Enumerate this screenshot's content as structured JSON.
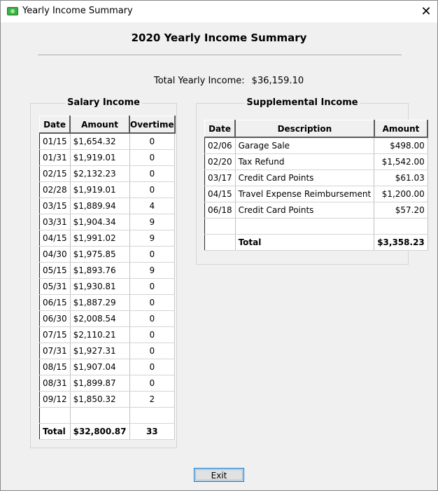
{
  "window": {
    "title": "Yearly Income Summary",
    "close_label": "✕"
  },
  "heading": "2020 Yearly Income Summary",
  "total_yearly": {
    "label": "Total Yearly Income:",
    "value": "$36,159.10"
  },
  "salary": {
    "title": "Salary Income",
    "headers": [
      "Date",
      "Amount",
      "Overtime"
    ],
    "rows": [
      [
        "01/15",
        "$1,654.32",
        "0"
      ],
      [
        "01/31",
        "$1,919.01",
        "0"
      ],
      [
        "02/15",
        "$2,132.23",
        "0"
      ],
      [
        "02/28",
        "$1,919.01",
        "0"
      ],
      [
        "03/15",
        "$1,889.94",
        "4"
      ],
      [
        "03/31",
        "$1,904.34",
        "9"
      ],
      [
        "04/15",
        "$1,991.02",
        "9"
      ],
      [
        "04/30",
        "$1,975.85",
        "0"
      ],
      [
        "05/15",
        "$1,893.76",
        "9"
      ],
      [
        "05/31",
        "$1,930.81",
        "0"
      ],
      [
        "06/15",
        "$1,887.29",
        "0"
      ],
      [
        "06/30",
        "$2,008.54",
        "0"
      ],
      [
        "07/15",
        "$2,110.21",
        "0"
      ],
      [
        "07/31",
        "$1,927.31",
        "0"
      ],
      [
        "08/15",
        "$1,907.04",
        "0"
      ],
      [
        "08/31",
        "$1,899.87",
        "0"
      ],
      [
        "09/12",
        "$1,850.32",
        "2"
      ]
    ],
    "total": [
      "Total",
      "$32,800.87",
      "33"
    ]
  },
  "supplemental": {
    "title": "Supplemental Income",
    "headers": [
      "Date",
      "Description",
      "Amount"
    ],
    "rows": [
      [
        "02/06",
        "Garage Sale",
        "$498.00"
      ],
      [
        "02/20",
        "Tax Refund",
        "$1,542.00"
      ],
      [
        "03/17",
        "Credit Card Points",
        "$61.03"
      ],
      [
        "04/15",
        "Travel Expense Reimbursement",
        "$1,200.00"
      ],
      [
        "06/18",
        "Credit Card Points",
        "$57.20"
      ]
    ],
    "total": [
      "",
      "Total",
      "$3,358.23"
    ]
  },
  "exit_label": "Exit",
  "colors": {
    "window_bg": "#f0f0f0",
    "accent": "#0078d7",
    "icon_green": "#3cb043"
  }
}
